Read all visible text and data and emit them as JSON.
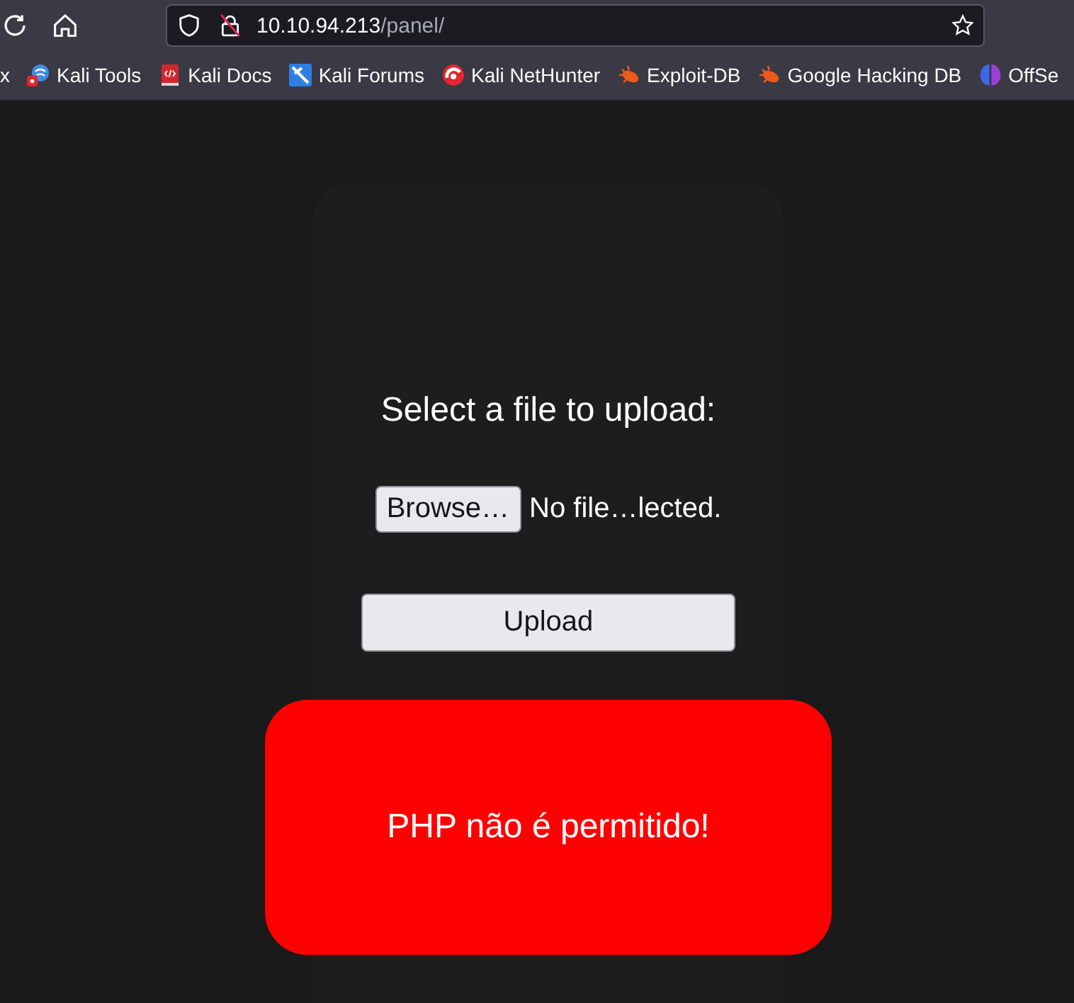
{
  "address_bar": {
    "host": "10.10.94.213",
    "path": "/panel/"
  },
  "bookmarks": [
    {
      "label": "x",
      "kind": "plain"
    },
    {
      "label": "Kali Tools",
      "kind": "tools"
    },
    {
      "label": "Kali Docs",
      "kind": "docs"
    },
    {
      "label": "Kali Forums",
      "kind": "forums"
    },
    {
      "label": "Kali NetHunter",
      "kind": "nethunter"
    },
    {
      "label": "Exploit-DB",
      "kind": "bug"
    },
    {
      "label": "Google Hacking DB",
      "kind": "bug"
    },
    {
      "label": "OffSe",
      "kind": "offsec"
    }
  ],
  "upload_form": {
    "title": "Select a file to upload:",
    "browse_button": "Browse…",
    "file_status": "No file…lected.",
    "submit_button": "Upload"
  },
  "alert": {
    "message": "PHP não é permitido!"
  }
}
